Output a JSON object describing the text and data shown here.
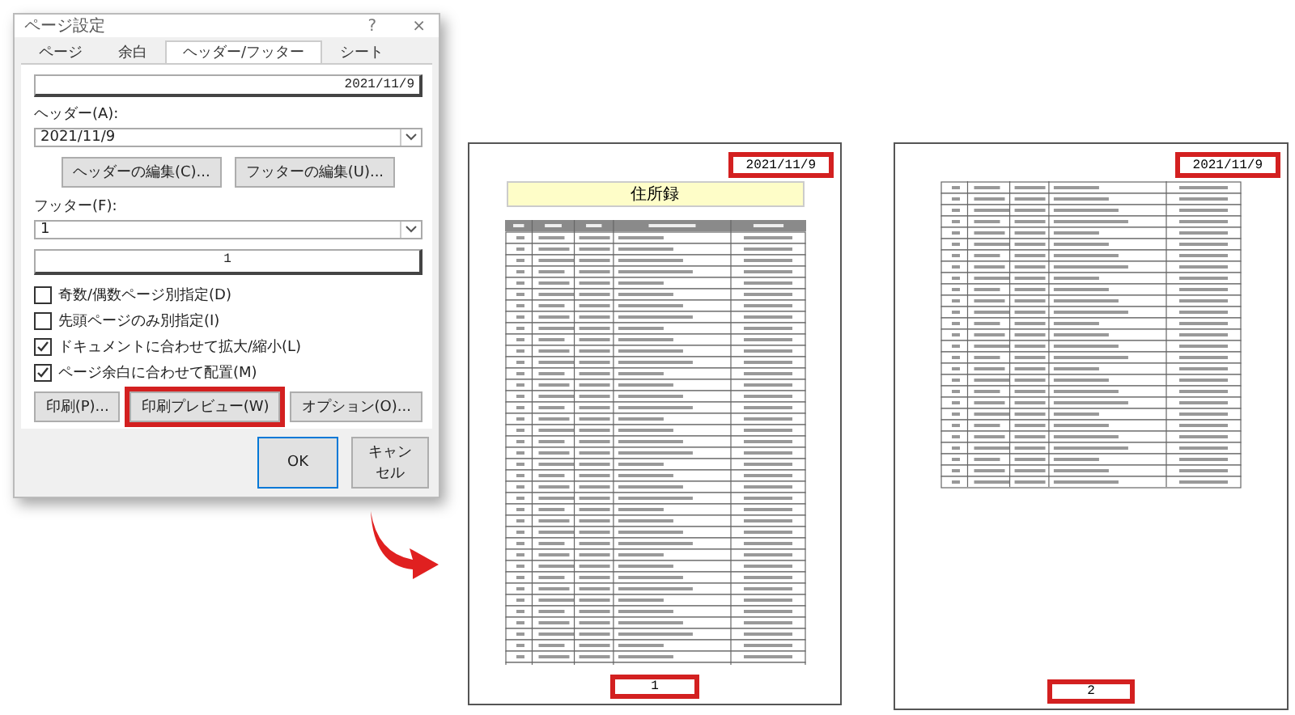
{
  "dialog": {
    "title": "ページ設定",
    "help": "?",
    "close": "×",
    "tabs": [
      {
        "label": "ページ",
        "selected": false
      },
      {
        "label": "余白",
        "selected": false
      },
      {
        "label": "ヘッダー/フッター",
        "selected": true
      },
      {
        "label": "シート",
        "selected": false
      }
    ],
    "header_preview": "2021/11/9",
    "header_label": "ヘッダー(A):",
    "header_value": "2021/11/9",
    "edit_buttons": [
      "ヘッダーの編集(C)...",
      "フッターの編集(U)..."
    ],
    "footer_label": "フッター(F):",
    "footer_value": "1",
    "footer_preview": "1",
    "checkboxes": [
      {
        "label": "奇数/偶数ページ別指定(D)",
        "checked": false
      },
      {
        "label": "先頭ページのみ別指定(I)",
        "checked": false
      },
      {
        "label": "ドキュメントに合わせて拡大/縮小(L)",
        "checked": true
      },
      {
        "label": "ページ余白に合わせて配置(M)",
        "checked": true
      }
    ],
    "action_buttons": [
      {
        "label": "印刷(P)...",
        "highlighted": false
      },
      {
        "label": "印刷プレビュー(W)",
        "highlighted": true
      },
      {
        "label": "オプション(O)...",
        "highlighted": false
      }
    ],
    "ok": "OK",
    "cancel": "キャンセル"
  },
  "pages": [
    {
      "header": "2021/11/9",
      "title": "住所録",
      "has_header_row": true,
      "footer": "1",
      "highlighted": true
    },
    {
      "header": "2021/11/9",
      "has_header_row": false,
      "footer": "2",
      "highlighted": true
    }
  ]
}
